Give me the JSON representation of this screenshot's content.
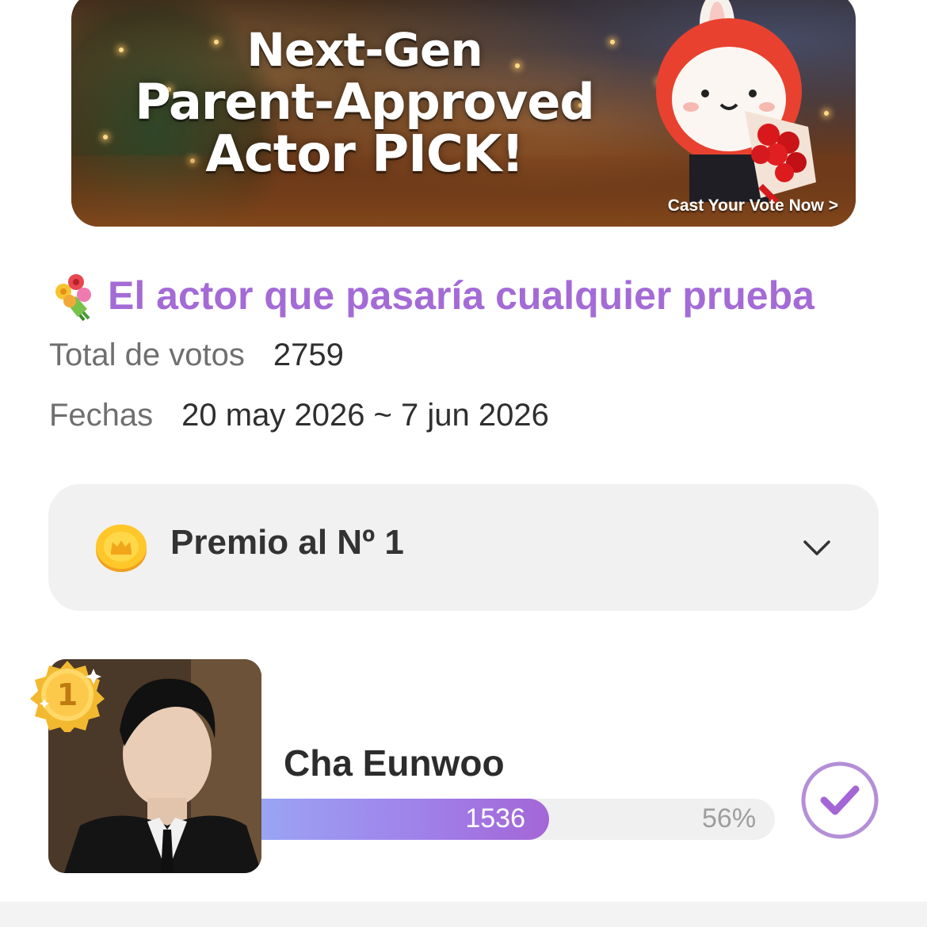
{
  "banner": {
    "title_line1": "Next-Gen",
    "title_line2": "Parent-Approved",
    "title_line3": "Actor PICK!",
    "cta": "Cast Your Vote Now >"
  },
  "poll": {
    "title": "El actor que pasaría cualquier prueba",
    "title_icon": "flower-bouquet-icon",
    "total_votes_label": "Total de votos",
    "total_votes_value": "2759",
    "dates_label": "Fechas",
    "dates_value": "20 may 2026 ~ 7 jun 2026"
  },
  "prize": {
    "label": "Premio al Nº 1",
    "icon": "gold-coin-icon",
    "toggle_icon": "chevron-down-icon"
  },
  "candidates": [
    {
      "rank": "1",
      "name": "Cha Eunwoo",
      "votes": "1536",
      "percent_label": "56%",
      "percent": 56,
      "selected_icon": "check-circle-icon"
    }
  ],
  "colors": {
    "accent": "#a46bd6",
    "bar_start": "#9aa4f4",
    "bar_end": "#a466d6",
    "check": "#b48fd8"
  }
}
